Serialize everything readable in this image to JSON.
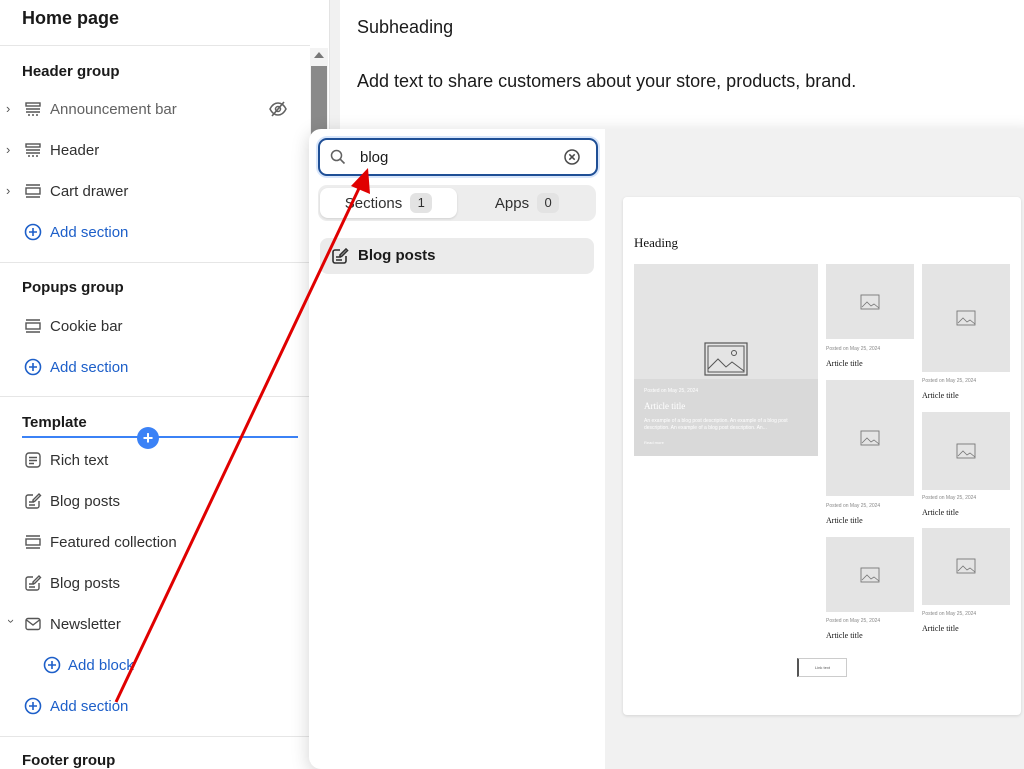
{
  "sidebar": {
    "title": "Home page",
    "header_group": {
      "title": "Header group",
      "items": [
        {
          "label": "Announcement bar",
          "icon": "section-icon",
          "hidden": true
        },
        {
          "label": "Header",
          "icon": "section-icon"
        },
        {
          "label": "Cart drawer",
          "icon": "section-icon"
        }
      ],
      "add": "Add section"
    },
    "popups_group": {
      "title": "Popups group",
      "items": [
        {
          "label": "Cookie bar",
          "icon": "section-icon"
        }
      ],
      "add": "Add section"
    },
    "template": {
      "title": "Template",
      "items": [
        {
          "label": "Rich text",
          "icon": "text-block-icon"
        },
        {
          "label": "Blog posts",
          "icon": "blog-icon"
        },
        {
          "label": "Featured collection",
          "icon": "section-icon"
        },
        {
          "label": "Blog posts",
          "icon": "blog-icon"
        },
        {
          "label": "Newsletter",
          "icon": "email-icon"
        }
      ],
      "add_block": "Add block",
      "add": "Add section"
    },
    "footer_group": {
      "title": "Footer group"
    }
  },
  "preview": {
    "subheading": "Subheading",
    "description": "Add text to share customers about your store, products, brand."
  },
  "picker": {
    "search_value": "blog",
    "tabs": [
      {
        "label": "Sections",
        "count": "1"
      },
      {
        "label": "Apps",
        "count": "0"
      }
    ],
    "result": {
      "label": "Blog posts",
      "icon": "blog-icon"
    }
  },
  "card": {
    "heading": "Heading",
    "featured": {
      "meta": "Posted on May 25, 2024",
      "title": "Article title",
      "desc": "An example of a blog post description. An example of a blog post description. An example of a blog post description. An...",
      "more": "Read more"
    },
    "posts": [
      {
        "meta": "Posted on May 25, 2024",
        "title": "Article title"
      },
      {
        "meta": "Posted on May 25, 2024",
        "title": "Article title"
      },
      {
        "meta": "Posted on May 25, 2024",
        "title": "Article title"
      },
      {
        "meta": "Posted on May 25, 2024",
        "title": "Article title"
      },
      {
        "meta": "Posted on May 25, 2024",
        "title": "Article title"
      },
      {
        "meta": "Posted on May 25, 2024",
        "title": "Article title"
      }
    ],
    "view_all": "Link text"
  },
  "colors": {
    "accent": "#1d5fc9",
    "focus_border": "#1f4f96",
    "insert_line": "#3b82f6",
    "annotation_arrow": "#e00000"
  }
}
